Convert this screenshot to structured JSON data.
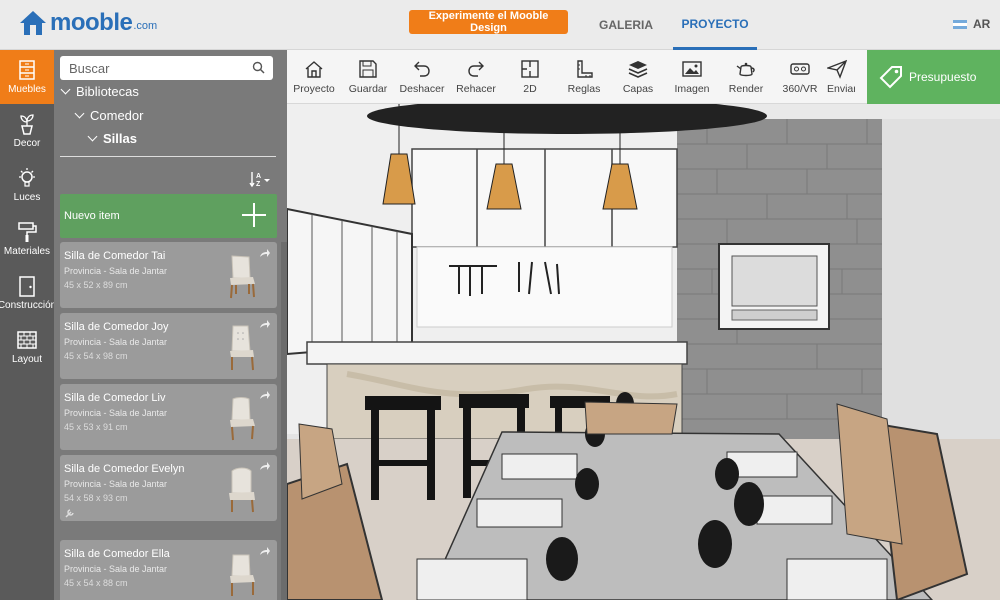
{
  "header": {
    "logo_text": "mooble",
    "logo_suffix": ".com",
    "promo_label": "Experimente el Mooble Design",
    "nav": [
      {
        "label": "GALERIA"
      },
      {
        "label": "PROYECTO"
      }
    ],
    "country": "AR"
  },
  "sidebar": {
    "items": [
      {
        "label": "Muebles",
        "icon": "cabinet-icon",
        "active": true
      },
      {
        "label": "Decor",
        "icon": "plant-icon"
      },
      {
        "label": "Luces",
        "icon": "lightbulb-icon"
      },
      {
        "label": "Materiales",
        "icon": "paint-roller-icon"
      },
      {
        "label": "Construcción",
        "icon": "door-icon"
      },
      {
        "label": "Layout",
        "icon": "brick-wall-icon"
      }
    ]
  },
  "catalog": {
    "search_placeholder": "Buscar",
    "tree": [
      {
        "label": "Bibliotecas"
      },
      {
        "label": "Comedor"
      },
      {
        "label": "Sillas"
      }
    ],
    "new_item_label": "Nuevo item",
    "items": [
      {
        "title": "Silla de Comedor Tai",
        "subtitle": "Provincia - Sala de Jantar",
        "dims": "45 x 52 x 89 cm"
      },
      {
        "title": "Silla de Comedor Joy",
        "subtitle": "Provincia - Sala de Jantar",
        "dims": "45 x 54 x 98 cm"
      },
      {
        "title": "Silla de Comedor Liv",
        "subtitle": "Provincia - Sala de Jantar",
        "dims": "45 x 53 x 91 cm"
      },
      {
        "title": "Silla de Comedor Evelyn",
        "subtitle": "Provincia - Sala de Jantar",
        "dims": "54 x 58 x 93 cm"
      },
      {
        "title": "Silla de Comedor Ella",
        "subtitle": "Provincia - Sala de Jantar",
        "dims": "45 x 54 x 88 cm"
      }
    ]
  },
  "toolbar": {
    "tools": [
      {
        "label": "Proyecto",
        "icon": "house-icon"
      },
      {
        "label": "Guardar",
        "icon": "floppy-icon"
      },
      {
        "label": "Deshacer",
        "icon": "undo-icon"
      },
      {
        "label": "Rehacer",
        "icon": "redo-icon"
      },
      {
        "label": "2D",
        "icon": "floorplan-icon"
      },
      {
        "label": "Reglas",
        "icon": "ruler-icon"
      },
      {
        "label": "Capas",
        "icon": "layers-icon"
      },
      {
        "label": "Imagen",
        "icon": "image-icon"
      },
      {
        "label": "Render",
        "icon": "teapot-icon"
      },
      {
        "label": "360/VR",
        "icon": "vr-icon"
      },
      {
        "label": "Enviar",
        "icon": "paper-plane-icon"
      }
    ],
    "budget_label": "Presupuesto"
  },
  "colors": {
    "brand_blue": "#2a6fb8",
    "accent_orange": "#f07d18",
    "budget_green": "#5fb35f",
    "new_item_green": "#5fa05f"
  }
}
